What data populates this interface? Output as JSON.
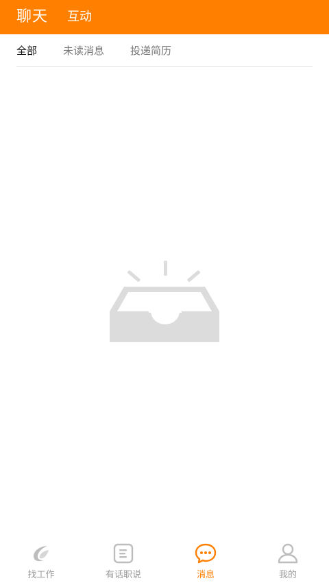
{
  "header": {
    "tabs": [
      {
        "label": "聊天",
        "active": true
      },
      {
        "label": "互动",
        "active": false
      }
    ],
    "background_color": "#ff8000"
  },
  "subtabs": [
    {
      "label": "全部",
      "active": true
    },
    {
      "label": "未读消息",
      "active": false
    },
    {
      "label": "投递简历",
      "active": false
    }
  ],
  "empty_state": {
    "icon": "empty-inbox-icon"
  },
  "bottom_nav": {
    "items": [
      {
        "label": "找工作",
        "icon": "swoosh-logo-icon",
        "active": false
      },
      {
        "label": "有话职说",
        "icon": "document-icon",
        "active": false
      },
      {
        "label": "消息",
        "icon": "chat-bubble-icon",
        "active": true
      },
      {
        "label": "我的",
        "icon": "user-icon",
        "active": false
      }
    ],
    "active_color": "#ff8000",
    "inactive_color": "#9a9a9a"
  }
}
